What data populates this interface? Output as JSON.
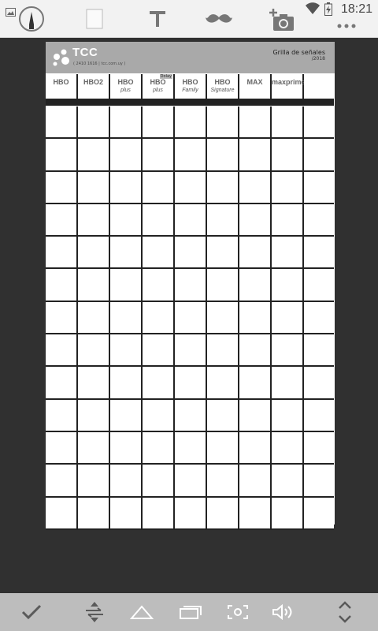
{
  "status": {
    "time": "18:21"
  },
  "toolbar": {
    "tools": [
      "pen-tool",
      "color-swatch",
      "text-tool",
      "mustache-sticker",
      "add-photo",
      "more-menu"
    ]
  },
  "document": {
    "brand": {
      "name": "TCC",
      "contact": "( 2410 1616 | tcc.com.uy )"
    },
    "grid_title": "Grilla de señales",
    "grid_year": "/2018",
    "channels": [
      {
        "label": "HBO",
        "sub": "",
        "tag": ""
      },
      {
        "label": "HBO2",
        "sub": "",
        "tag": ""
      },
      {
        "label": "HBO",
        "sub": "plus",
        "tag": ""
      },
      {
        "label": "HBO",
        "sub": "plus",
        "tag": "Dolay"
      },
      {
        "label": "HBO",
        "sub": "Family",
        "tag": ""
      },
      {
        "label": "HBO",
        "sub": "Signature",
        "tag": ""
      },
      {
        "label": "MAX",
        "sub": "",
        "tag": ""
      },
      {
        "label": "maxprime",
        "sub": "",
        "tag": ""
      },
      {
        "label": "",
        "sub": "",
        "tag": ""
      }
    ],
    "grid_rows": 13,
    "grid_cols": 9
  },
  "bottombar": {
    "buttons": [
      "confirm",
      "swap",
      "home",
      "recents",
      "screenshot",
      "volume",
      "expand"
    ]
  },
  "colors": {
    "toolbar_bg": "#f2f2f2",
    "canvas_bg": "#303030",
    "header_bg": "#a9a9a9",
    "bottom_bg": "#bdbdbd"
  }
}
